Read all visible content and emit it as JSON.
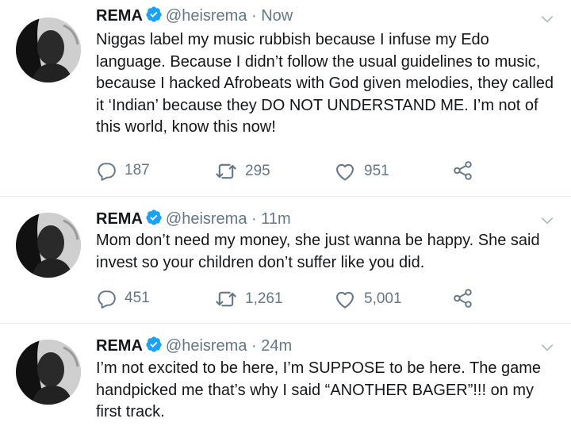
{
  "tweets": [
    {
      "name": "REMA",
      "handle": "@heisrema",
      "time": "Now",
      "text": "Niggas label my music rubbish because I infuse my Edo language. Because I didn’t follow the usual guidelines to music, because I hacked Afrobeats with God given melodies, they called it ‘Indian’ because they DO NOT UNDERSTAND ME. I’m not of this world, know this now!",
      "replies": "187",
      "retweets": "295",
      "likes": "951"
    },
    {
      "name": "REMA",
      "handle": "@heisrema",
      "time": "11m",
      "text": "Mom don’t need my money, she just wanna be happy. She said invest so your children don’t suffer like you did.",
      "replies": "451",
      "retweets": "1,261",
      "likes": "5,001"
    },
    {
      "name": "REMA",
      "handle": "@heisrema",
      "time": "24m",
      "text": "I’m not excited to be here, I’m SUPPOSE to be here. The game handpicked me that’s why I said “ANOTHER BAGER”!!! on my first track."
    }
  ],
  "separator": " · ",
  "colors": {
    "text": "#14171a",
    "muted": "#657786",
    "verified": "#1da1f2",
    "divider": "#e6ecf0"
  },
  "icons": [
    "verified-badge-icon",
    "chevron-down-icon",
    "reply-icon",
    "retweet-icon",
    "like-icon",
    "share-icon"
  ]
}
